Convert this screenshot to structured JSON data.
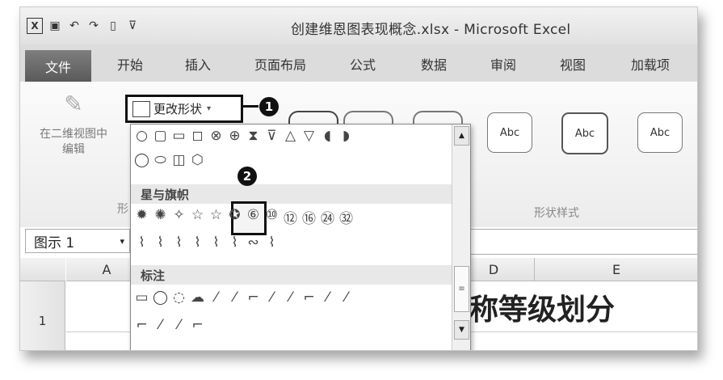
{
  "window": {
    "title": "创建维恩图表现概念.xlsx - Microsoft Excel"
  },
  "quick_access": {
    "icons": [
      "excel-logo-icon",
      "save-icon",
      "undo-icon",
      "redo-icon",
      "new-doc-icon",
      "customize-icon"
    ],
    "glyphs": [
      "X",
      "▣",
      "↶",
      "↷",
      "▯",
      "⊽"
    ]
  },
  "tabs": [
    "文件",
    "开始",
    "插入",
    "页面布局",
    "公式",
    "数据",
    "审阅",
    "视图",
    "加载项"
  ],
  "ribbon": {
    "edit_button": {
      "line1": "在二维视图中",
      "line2": "编辑"
    },
    "change_shape_label": "更改形状",
    "group_label_left": "形",
    "group_label_styles": "形状样式",
    "styles": [
      "Abc",
      "Abc",
      "Abc"
    ]
  },
  "callouts": {
    "one": "1",
    "two": "2"
  },
  "dropdown": {
    "row_basic_1": [
      "○",
      "▢",
      "▭",
      "◻",
      "⊗",
      "⊕",
      "⧗",
      "⊽",
      "△",
      "▽",
      "◖",
      "◗"
    ],
    "row_basic_2": [
      "◯",
      "⬭",
      "◫",
      "⬡"
    ],
    "section_stars": "星与旗帜",
    "row_stars_1": [
      "✹",
      "✺",
      "✧",
      "☆",
      "☆",
      "✪",
      "⑥",
      "⑩",
      "⑫",
      "⑯",
      "㉔",
      "㉜"
    ],
    "row_stars_2": [
      "⌇",
      "⌇",
      "⌇",
      "⌇",
      "⌇",
      "⌇",
      "∾",
      "⌇"
    ],
    "section_callouts": "标注",
    "row_callout_1": [
      "▭",
      "◯",
      "◌",
      "☁",
      "⁄",
      "⁄",
      "⌐",
      "⁄",
      "⁄",
      "⌐",
      "⁄",
      "⁄"
    ],
    "row_callout_2": [
      "⌐",
      "⁄",
      "⁄",
      "⌐"
    ]
  },
  "sheet": {
    "namebox": "图示 1",
    "columns": [
      "A",
      "D",
      "E"
    ],
    "row1": "1",
    "cell_text": "称等级划分"
  }
}
